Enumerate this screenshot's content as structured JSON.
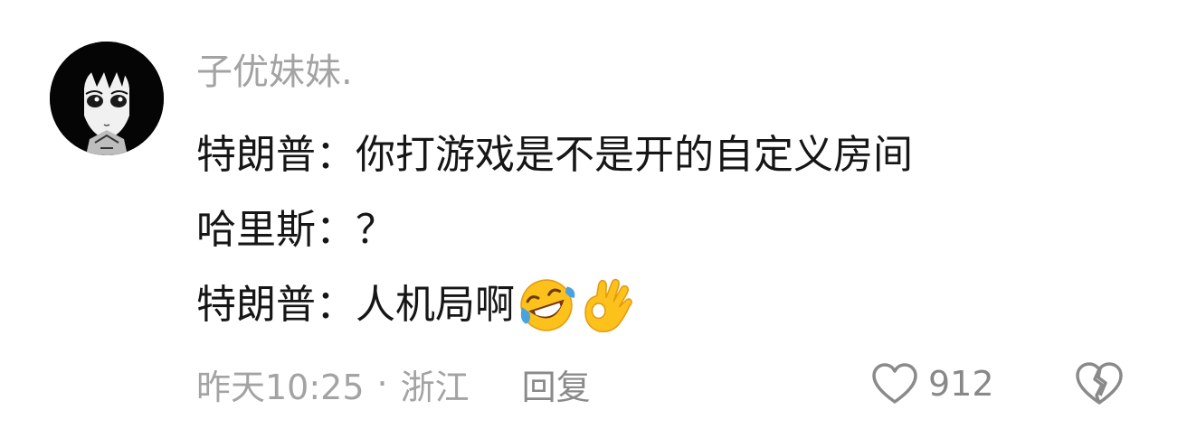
{
  "comment": {
    "username": "子优妹妹.",
    "lines": [
      "特朗普：你打游戏是不是开的自定义房间",
      "哈里斯：？",
      "特朗普：人机局啊"
    ],
    "emojis": [
      "rolling-on-floor-laughing",
      "ok-hand"
    ],
    "timestamp": "昨天10:25",
    "separator": "·",
    "location": "浙江",
    "reply_label": "回复",
    "like_count": "912"
  },
  "icons": {
    "like": "heart-outline-icon",
    "dislike": "broken-heart-icon"
  },
  "colors": {
    "username": "#a3a3a3",
    "text": "#161616",
    "meta": "#a3a3a3",
    "emoji_yellow": "#fcc21b"
  }
}
